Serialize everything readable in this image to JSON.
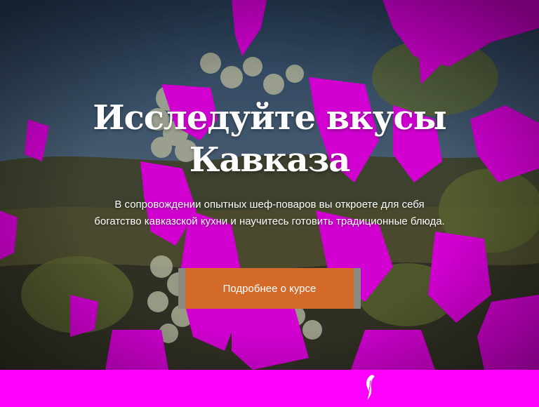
{
  "hero": {
    "title_line1": "Исследуйте вкусы",
    "title_line2": "Кавказа",
    "description": "В сопровождении опытных шеф-поваров вы откроете для себя богатство кавказской кухни и научитесь готовить традиционные блюда.",
    "cta_label": "Подробнее о курсе",
    "background": "grapes-vineyard-photo"
  },
  "colors": {
    "accent": "#d36a2a",
    "overlay_magenta": "#ff00ff",
    "text": "#ffffff"
  },
  "footer": {
    "icon": "feather-logo-icon"
  }
}
